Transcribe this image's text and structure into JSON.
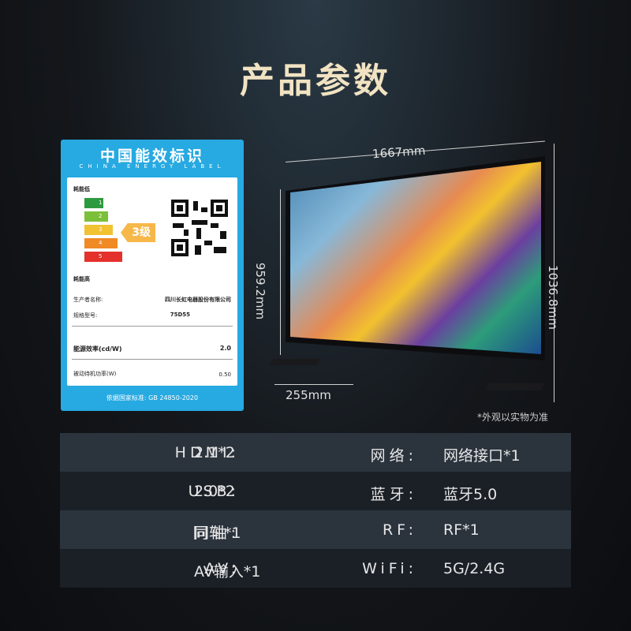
{
  "title": "产品参数",
  "energy_label": {
    "header": "中国能效标识",
    "subheader": "CHINA ENERGY LABEL",
    "low_label": "耗能低",
    "high_label": "耗能高",
    "grades": [
      "1",
      "2",
      "3",
      "4",
      "5"
    ],
    "grade_colors": [
      "#2e9a3f",
      "#7bbf3a",
      "#f1c232",
      "#f08a24",
      "#e4312b"
    ],
    "rating": "3级",
    "manufacturer_label": "生产者名称:",
    "manufacturer": "四川长虹电器股份有限公司",
    "model_label": "规格型号:",
    "model": "75D55",
    "efficiency_label": "能源效率(cd/W)",
    "efficiency": "2.0",
    "standby_label": "被动待机功率(W)",
    "standby": "0.50",
    "standard": "依据国家标准: GB 24850-2020"
  },
  "tv": {
    "width": "1667mm",
    "height_screen": "959.2mm",
    "height_total": "1036.8mm",
    "stand_depth": "255mm",
    "note": "*外观以实物为准"
  },
  "specs": [
    {
      "k1": "HDMI:",
      "v1": "2.1*2",
      "k2": "网络:",
      "v2": "网络接口*1"
    },
    {
      "k1": "USB:",
      "v1": "2.0*2",
      "k2": "蓝牙:",
      "v2": "蓝牙5.0"
    },
    {
      "k1": "同轴:",
      "v1": "同轴*1",
      "k2": "RF:",
      "v2": "RF*1"
    },
    {
      "k1": "AV:",
      "v1": "AV输入*1",
      "k2": "WiFi:",
      "v2": "5G/2.4G"
    }
  ]
}
